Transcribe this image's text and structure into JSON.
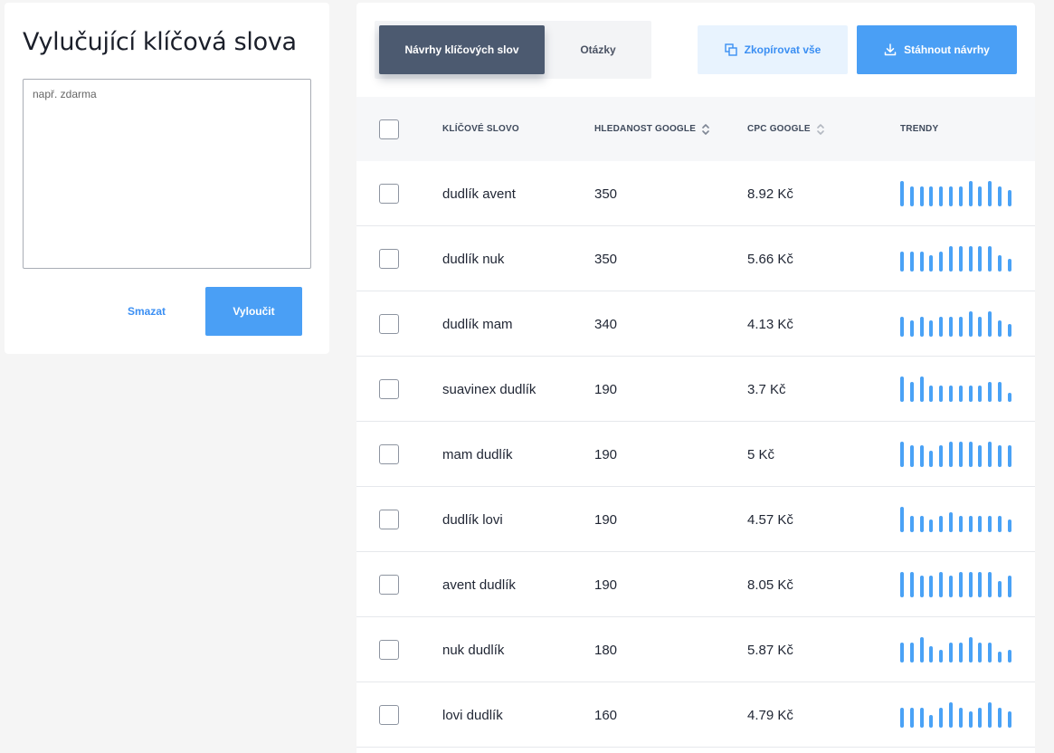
{
  "exclude_panel": {
    "title": "Vylučující klíčová slova",
    "textarea_placeholder": "např. zdarma",
    "clear_label": "Smazat",
    "exclude_label": "Vyloučit"
  },
  "tabs": [
    {
      "label": "Návrhy klíčových slov",
      "active": true
    },
    {
      "label": "Otázky",
      "active": false
    }
  ],
  "actions": {
    "copy_label": "Zkopírovat vše",
    "copy_icon": "copy-icon",
    "download_label": "Stáhnout návrhy",
    "download_icon": "download-icon"
  },
  "table": {
    "columns": {
      "keyword": "KLÍČOVÉ SLOVO",
      "volume": "HLEDANOST GOOGLE",
      "cpc": "CPC GOOGLE",
      "trends": "TRENDY"
    },
    "rows": [
      {
        "keyword": "dudlík avent",
        "volume": "350",
        "cpc": "8.92 Kč",
        "trend": [
          0.93,
          0.73,
          0.73,
          0.73,
          0.73,
          0.73,
          0.73,
          0.93,
          0.73,
          0.93,
          0.73,
          0.6
        ]
      },
      {
        "keyword": "dudlík nuk",
        "volume": "350",
        "cpc": "5.66 Kč",
        "trend": [
          0.73,
          0.73,
          0.73,
          0.6,
          0.73,
          0.93,
          0.93,
          0.93,
          0.93,
          0.93,
          0.6,
          0.47
        ]
      },
      {
        "keyword": "dudlík mam",
        "volume": "340",
        "cpc": "4.13 Kč",
        "trend": [
          0.73,
          0.6,
          0.73,
          0.6,
          0.73,
          0.73,
          0.73,
          0.93,
          0.73,
          0.93,
          0.6,
          0.47
        ]
      },
      {
        "keyword": "suavinex dudlík",
        "volume": "190",
        "cpc": "3.7 Kč",
        "trend": [
          0.93,
          0.73,
          0.93,
          0.6,
          0.6,
          0.6,
          0.6,
          0.6,
          0.6,
          0.73,
          0.73,
          0.33
        ]
      },
      {
        "keyword": "mam dudlík",
        "volume": "190",
        "cpc": "5 Kč",
        "trend": [
          0.93,
          0.8,
          0.8,
          0.6,
          0.8,
          0.93,
          0.93,
          0.93,
          0.8,
          0.93,
          0.8,
          0.8
        ]
      },
      {
        "keyword": "dudlík lovi",
        "volume": "190",
        "cpc": "4.57 Kč",
        "trend": [
          0.93,
          0.6,
          0.6,
          0.47,
          0.6,
          0.73,
          0.6,
          0.6,
          0.6,
          0.6,
          0.6,
          0.47
        ]
      },
      {
        "keyword": "avent dudlík",
        "volume": "190",
        "cpc": "8.05 Kč",
        "trend": [
          0.93,
          0.93,
          0.8,
          0.8,
          0.93,
          0.8,
          0.93,
          0.93,
          0.93,
          0.93,
          0.6,
          0.8
        ]
      },
      {
        "keyword": "nuk dudlík",
        "volume": "180",
        "cpc": "5.87 Kč",
        "trend": [
          0.73,
          0.73,
          0.93,
          0.6,
          0.47,
          0.73,
          0.73,
          0.93,
          0.73,
          0.73,
          0.4,
          0.47
        ]
      },
      {
        "keyword": "lovi dudlík",
        "volume": "160",
        "cpc": "4.79 Kč",
        "trend": [
          0.73,
          0.73,
          0.73,
          0.47,
          0.73,
          0.93,
          0.73,
          0.6,
          0.73,
          0.93,
          0.73,
          0.6
        ]
      }
    ]
  },
  "colors": {
    "accent": "#4a9ff5",
    "accent_light": "#e8f3fe",
    "tab_active": "#4c5a70",
    "trend_bar": "#4aa2f6"
  }
}
